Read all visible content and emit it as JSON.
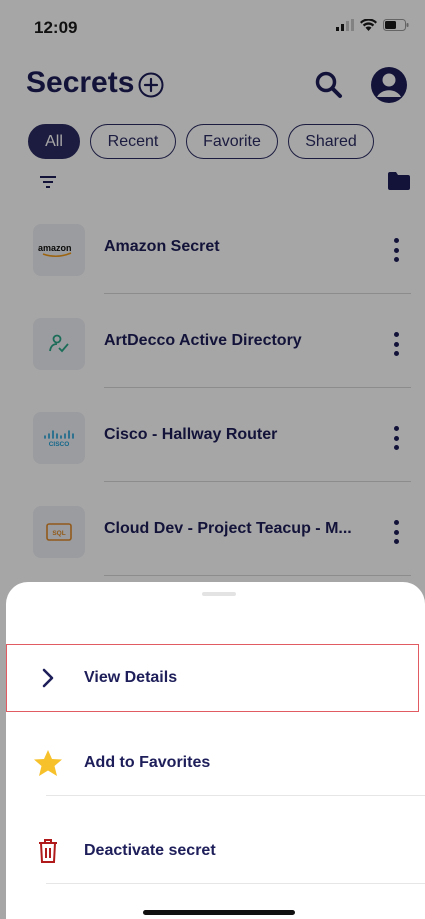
{
  "status_bar": {
    "time": "12:09"
  },
  "header": {
    "title": "Secrets"
  },
  "filters": [
    {
      "label": "All",
      "active": true
    },
    {
      "label": "Recent",
      "active": false
    },
    {
      "label": "Favorite",
      "active": false
    },
    {
      "label": "Shared",
      "active": false
    }
  ],
  "secrets": [
    {
      "name": "Amazon Secret",
      "logo_text": "amazon",
      "icon": "amazon-logo"
    },
    {
      "name": "ArtDecco Active Directory",
      "logo_text": "",
      "icon": "user-check-icon"
    },
    {
      "name": "Cisco - Hallway Router",
      "logo_text": "CISCO",
      "icon": "cisco-logo"
    },
    {
      "name": "Cloud Dev - Project Teacup - M...",
      "logo_text": "SQL",
      "icon": "sql-logo"
    }
  ],
  "sheet": {
    "view_details": "View Details",
    "add_favorites": "Add to Favorites",
    "deactivate": "Deactivate secret"
  },
  "colors": {
    "navy": "#1e1e5a",
    "danger": "#b01a1a",
    "star": "#f6c12b",
    "highlight": "#e15b63"
  }
}
